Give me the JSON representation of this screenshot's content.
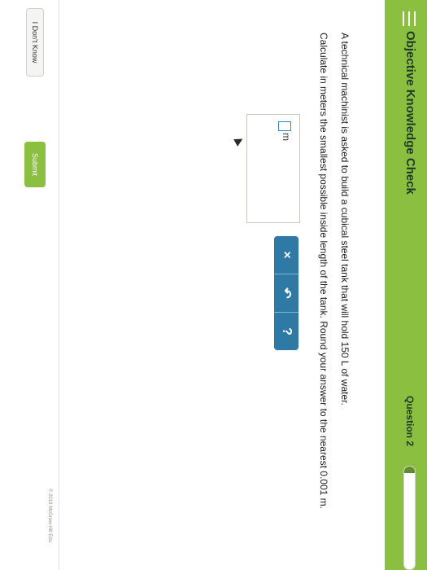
{
  "header": {
    "title": "Objective Knowledge Check",
    "question_label": "Question 2",
    "progress_fraction": 0.06
  },
  "question": {
    "line1": "A technical machinist is asked to build a cubical steel tank that will hold 150 L of water.",
    "line2": "Calculate in meters the smallest possible inside length of the tank. Round your answer to the nearest 0.001 m."
  },
  "answer": {
    "unit": "m"
  },
  "keypad": {
    "clear": "×",
    "undo": "↶",
    "help": "?"
  },
  "footer": {
    "dont_know": "I Don't Know",
    "submit": "Submit",
    "copyright": "© 2019 McGraw-Hill Edu"
  },
  "colors": {
    "header_green": "#8bbf3f",
    "keypad_blue": "#2f7aa4"
  }
}
